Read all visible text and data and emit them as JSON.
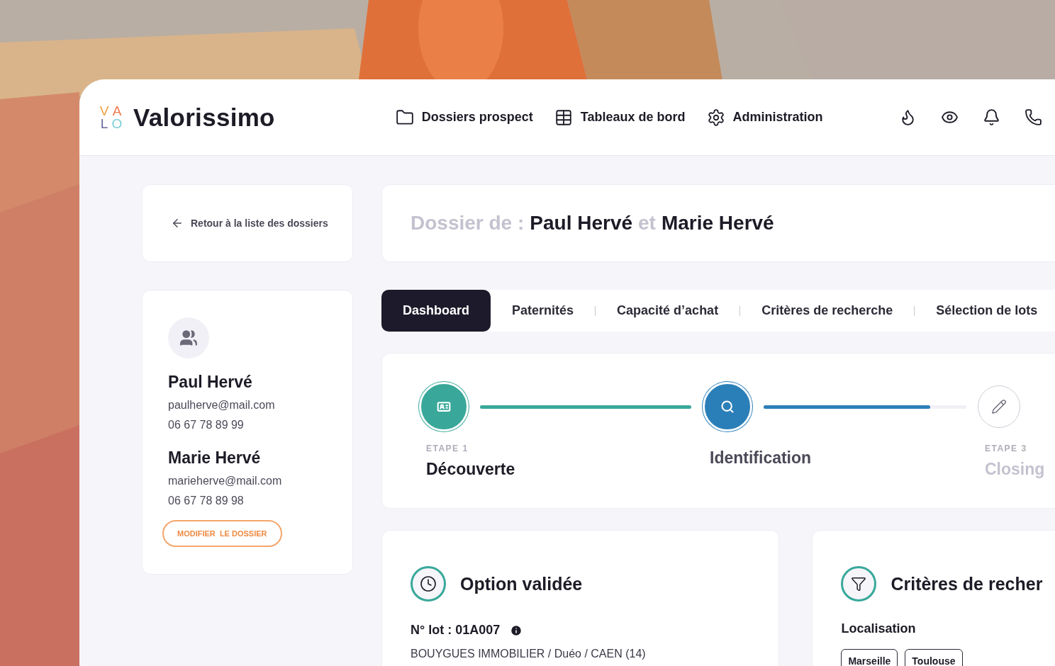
{
  "header": {
    "logo_letters": [
      "V",
      "A",
      "L",
      "O"
    ],
    "brand": "Valorissimo",
    "nav": [
      {
        "kind": "folder",
        "label": "Dossiers prospect"
      },
      {
        "kind": "table",
        "label": "Tableaux de bord"
      },
      {
        "kind": "gear",
        "label": "Administration"
      }
    ],
    "actions": [
      {
        "kind": "flame"
      },
      {
        "kind": "eye"
      },
      {
        "kind": "bell"
      },
      {
        "kind": "phone"
      }
    ]
  },
  "back_link": "Retour à la liste des dossiers",
  "contacts": [
    {
      "name": "Paul Hervé",
      "email": "paulherve@mail.com",
      "phone": "06 67 78 89 99"
    },
    {
      "name": "Marie Hervé",
      "email": "marieherve@mail.com",
      "phone": "06 67 78 89 98"
    }
  ],
  "edit_button": "MODIFIER  LE DOSSIER",
  "title_parts": [
    {
      "kind": "muted",
      "text": "Dossier de :"
    },
    {
      "kind": "name",
      "text": "Paul Hervé"
    },
    {
      "kind": "muted",
      "text": "et"
    },
    {
      "kind": "name",
      "text": "Marie Hervé"
    }
  ],
  "tabs": [
    {
      "label": "Dashboard",
      "selected": true
    },
    {
      "label": "Paternités",
      "selected": false
    },
    {
      "label": "Capacité d’achat",
      "selected": false
    },
    {
      "label": "Critères de recherche",
      "selected": false
    },
    {
      "label": "Sélection de lots",
      "selected": false
    }
  ],
  "steps": [
    {
      "kind": "done",
      "caption": "ETAPE 1",
      "title": "Découverte",
      "level": 1
    },
    {
      "kind": "current",
      "title": "Identification",
      "level": 0.82
    },
    {
      "kind": "todo",
      "caption": "ETAPE 3",
      "title": "Closing"
    }
  ],
  "option_card": {
    "title": "Option validée",
    "lot": "N° lot : 01A007",
    "description": "BOUYGUES IMMOBILIER / Duéo / CAEN (14)"
  },
  "criteria_card": {
    "title": "Critères de recher",
    "section": "Localisation",
    "tags": [
      "Marseille",
      "Toulouse"
    ]
  }
}
